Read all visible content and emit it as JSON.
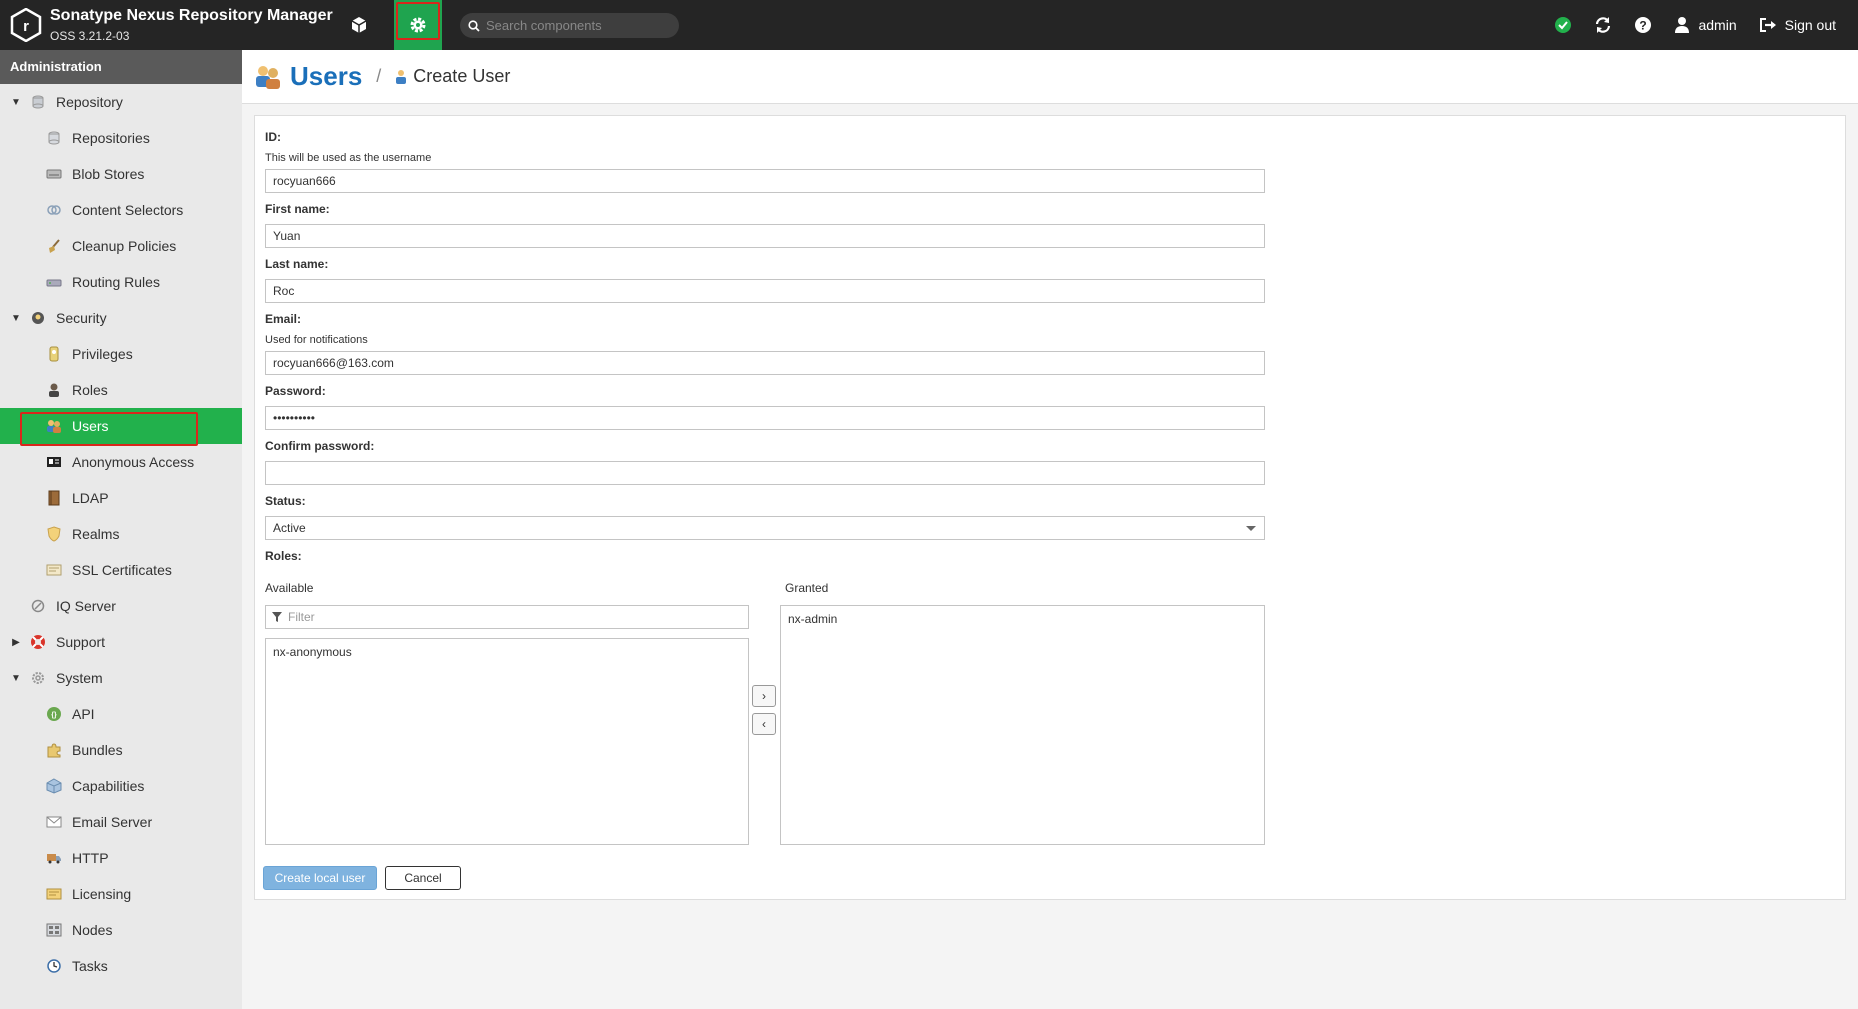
{
  "header": {
    "title": "Sonatype Nexus Repository Manager",
    "version": "OSS 3.21.2-03",
    "search_placeholder": "Search components",
    "user": "admin",
    "signout": "Sign out"
  },
  "sidebar": {
    "header": "Administration",
    "items": [
      {
        "label": "Repository",
        "level": 0,
        "expanded": true,
        "icon": "database-icon"
      },
      {
        "label": "Repositories",
        "level": 1,
        "icon": "database-icon"
      },
      {
        "label": "Blob Stores",
        "level": 1,
        "icon": "hard-drive-icon"
      },
      {
        "label": "Content Selectors",
        "level": 1,
        "icon": "content-selector-icon"
      },
      {
        "label": "Cleanup Policies",
        "level": 1,
        "icon": "broom-icon"
      },
      {
        "label": "Routing Rules",
        "level": 1,
        "icon": "router-icon"
      },
      {
        "label": "Security",
        "level": 0,
        "expanded": true,
        "icon": "security-icon"
      },
      {
        "label": "Privileges",
        "level": 1,
        "icon": "badge-icon"
      },
      {
        "label": "Roles",
        "level": 1,
        "icon": "role-icon"
      },
      {
        "label": "Users",
        "level": 1,
        "selected": true,
        "icon": "users-icon"
      },
      {
        "label": "Anonymous Access",
        "level": 1,
        "icon": "id-card-icon"
      },
      {
        "label": "LDAP",
        "level": 1,
        "icon": "book-icon"
      },
      {
        "label": "Realms",
        "level": 1,
        "icon": "shield-icon"
      },
      {
        "label": "SSL Certificates",
        "level": 1,
        "icon": "certificate-icon"
      },
      {
        "label": "IQ Server",
        "level": 0,
        "icon": "iq-server-icon"
      },
      {
        "label": "Support",
        "level": 0,
        "expanded": false,
        "icon": "lifebuoy-icon"
      },
      {
        "label": "System",
        "level": 0,
        "expanded": true,
        "icon": "gear-icon"
      },
      {
        "label": "API",
        "level": 1,
        "icon": "api-icon"
      },
      {
        "label": "Bundles",
        "level": 1,
        "icon": "puzzle-icon"
      },
      {
        "label": "Capabilities",
        "level": 1,
        "icon": "cube-icon"
      },
      {
        "label": "Email Server",
        "level": 1,
        "icon": "envelope-icon"
      },
      {
        "label": "HTTP",
        "level": 1,
        "icon": "truck-icon"
      },
      {
        "label": "Licensing",
        "level": 1,
        "icon": "license-icon"
      },
      {
        "label": "Nodes",
        "level": 1,
        "icon": "nodes-icon"
      },
      {
        "label": "Tasks",
        "level": 1,
        "icon": "clock-icon"
      }
    ]
  },
  "breadcrumb": {
    "section": "Users",
    "separator": "/",
    "page": "Create User"
  },
  "form": {
    "id": {
      "label": "ID:",
      "help": "This will be used as the username",
      "value": "rocyuan666"
    },
    "first_name": {
      "label": "First name:",
      "value": "Yuan"
    },
    "last_name": {
      "label": "Last name:",
      "value": "Roc"
    },
    "email": {
      "label": "Email:",
      "help": "Used for notifications",
      "value": "rocyuan666@163.com"
    },
    "password": {
      "label": "Password:",
      "value": "••••••••••"
    },
    "confirm_password": {
      "label": "Confirm password:",
      "value": ""
    },
    "status": {
      "label": "Status:",
      "value": "Active"
    },
    "roles": {
      "label": "Roles:",
      "available_title": "Available",
      "granted_title": "Granted",
      "filter_placeholder": "Filter",
      "available": [
        "nx-anonymous"
      ],
      "granted": [
        "nx-admin"
      ],
      "add_label": "›",
      "remove_label": "‹"
    },
    "submit_label": "Create local user",
    "cancel_label": "Cancel"
  }
}
